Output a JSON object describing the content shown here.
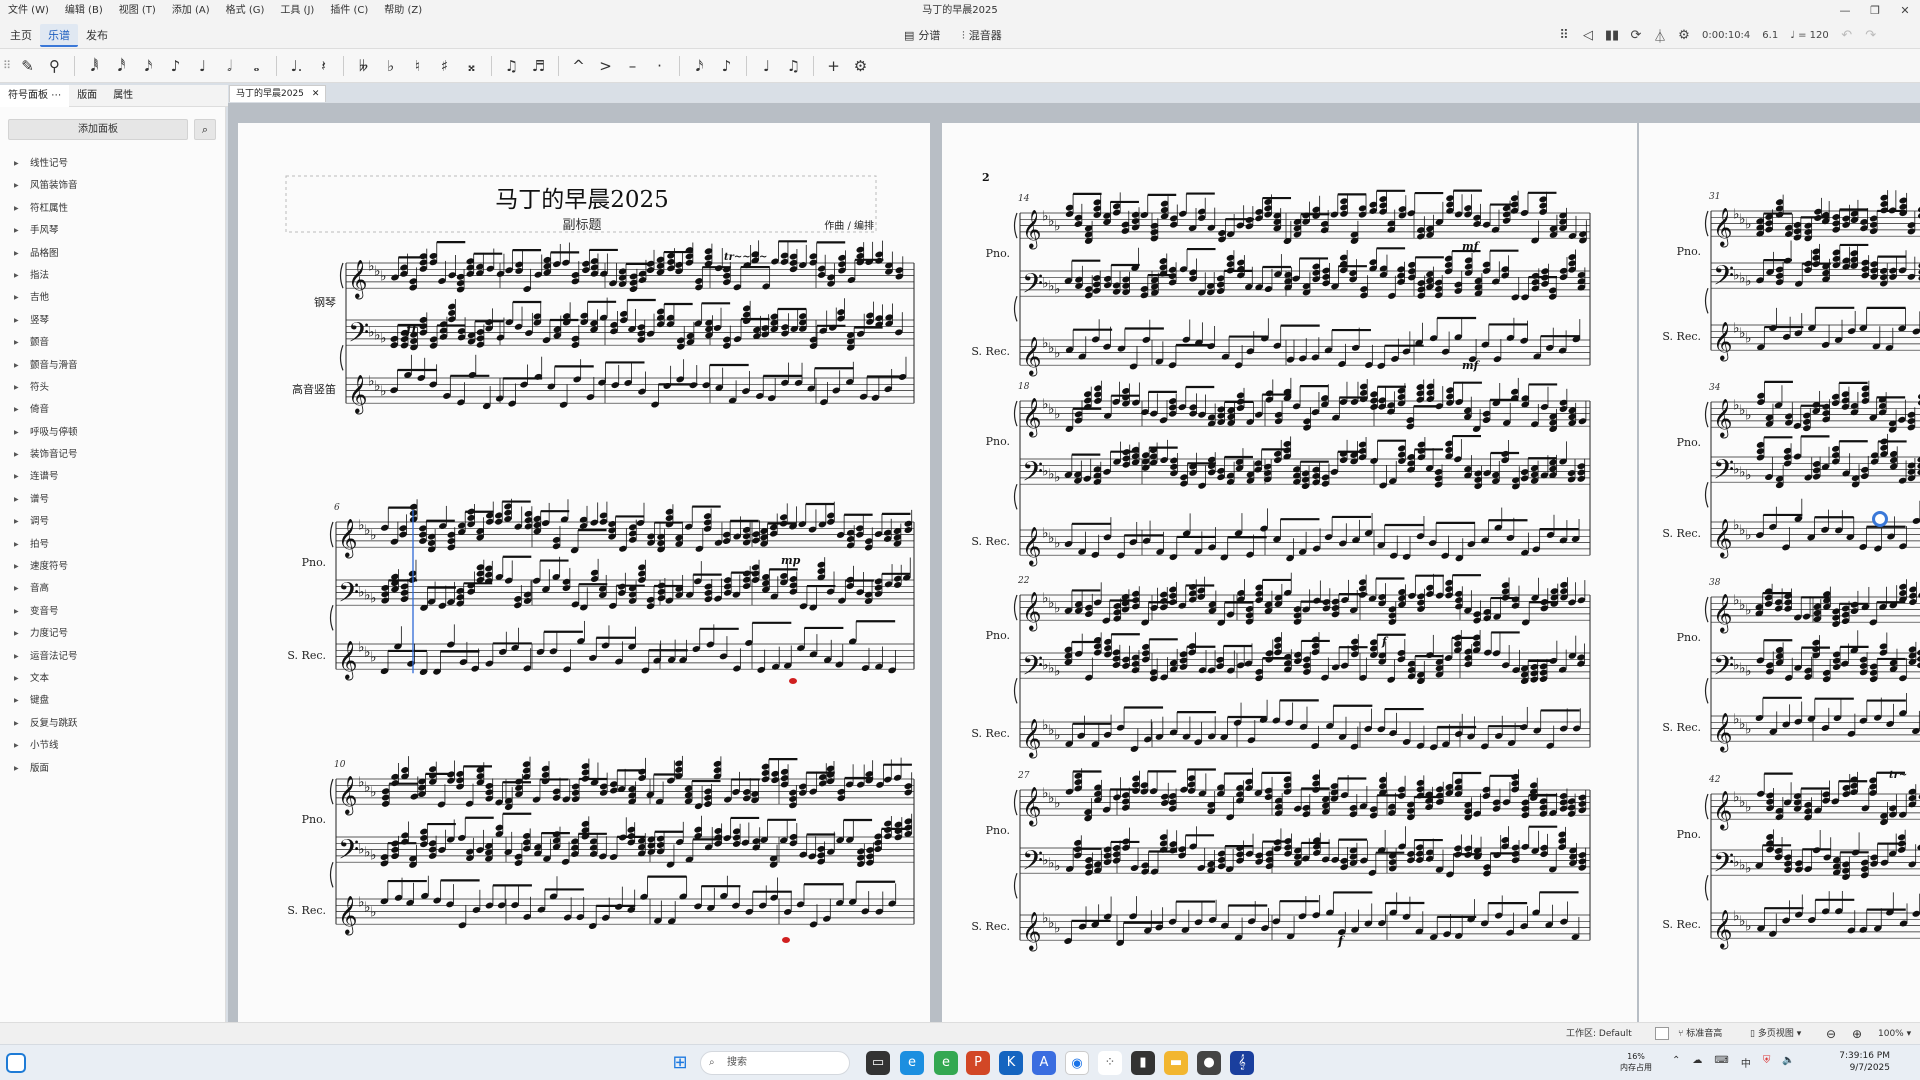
{
  "window": {
    "title": "马丁的早晨2025"
  },
  "menu": [
    "文件 (W)",
    "编辑 (B)",
    "视图 (T)",
    "添加 (A)",
    "格式 (G)",
    "工具 (J)",
    "插件 (C)",
    "帮助 (Z)"
  ],
  "window_controls": [
    "—",
    "❐",
    "✕"
  ],
  "app_tabs": [
    "主页",
    "乐谱",
    "发布"
  ],
  "active_app_tab": "乐谱",
  "center_tools": {
    "parts": "分谱",
    "mixer": "混音器"
  },
  "playback": {
    "time": "0:00:10:4",
    "position": "6.1",
    "tempo": "♩ = 120"
  },
  "note_toolbar": [
    "✎",
    "⚲",
    "𝅘𝅥𝅱",
    "𝅘𝅥𝅰",
    "𝅘𝅥𝅯",
    "♪",
    "♩",
    "𝅗𝅥",
    "𝅝",
    "♩.",
    "𝄽",
    "𝄫",
    "♭",
    "♮",
    "♯",
    "𝄪",
    "♫",
    "♬",
    "^",
    ">",
    "–",
    "·",
    "𝅘𝅥𝅯",
    "♪",
    "♩",
    "♫",
    "+",
    "⚙"
  ],
  "panel_tabs": [
    "符号面板",
    "版面",
    "属性"
  ],
  "panel": {
    "add_label": "添加面板",
    "items": [
      "线性记号",
      "风笛装饰音",
      "符杠属性",
      "手风琴",
      "品格图",
      "指法",
      "吉他",
      "竖琴",
      "颤音",
      "颤音与滑音",
      "符头",
      "倚音",
      "呼吸与停顿",
      "装饰音记号",
      "连谱号",
      "谱号",
      "调号",
      "拍号",
      "速度符号",
      "音高",
      "变音号",
      "力度记号",
      "运音法记号",
      "文本",
      "键盘",
      "反复与跳跃",
      "小节线",
      "版面"
    ]
  },
  "doc_tab": {
    "label": "马丁的早晨2025",
    "close": "✕"
  },
  "score": {
    "title": "马丁的早晨2025",
    "subtitle": "副标题",
    "composer": "作曲 / 编排",
    "page2_number": "2",
    "first_system_labels": [
      "钢琴",
      "高音竖笛"
    ],
    "short_labels": {
      "piano": "Pno.",
      "recorder": "S. Rec."
    },
    "page1_measure_numbers": [
      "6",
      "10"
    ],
    "page2_measure_numbers": [
      "14",
      "18",
      "22",
      "27"
    ],
    "page3_measure_numbers": [
      "31",
      "34",
      "38",
      "42"
    ],
    "dynamics": {
      "ff": "ff",
      "mp": "mp",
      "mf": "mf",
      "f": "f"
    },
    "trill": "tr"
  },
  "statusbar": {
    "workspace": "工作区: Default",
    "concert_pitch": "标准音高",
    "view_mode": "多页视图",
    "zoom": "100%"
  },
  "taskbar": {
    "search": "搜索",
    "cpu": "16%",
    "memory": "内存占用",
    "time": "7:39:16 PM",
    "date": "9/7/2025"
  },
  "colors": {
    "accent": "#3a78d8",
    "selection": "#2e6ad6",
    "error_note": "#d01f1f"
  }
}
